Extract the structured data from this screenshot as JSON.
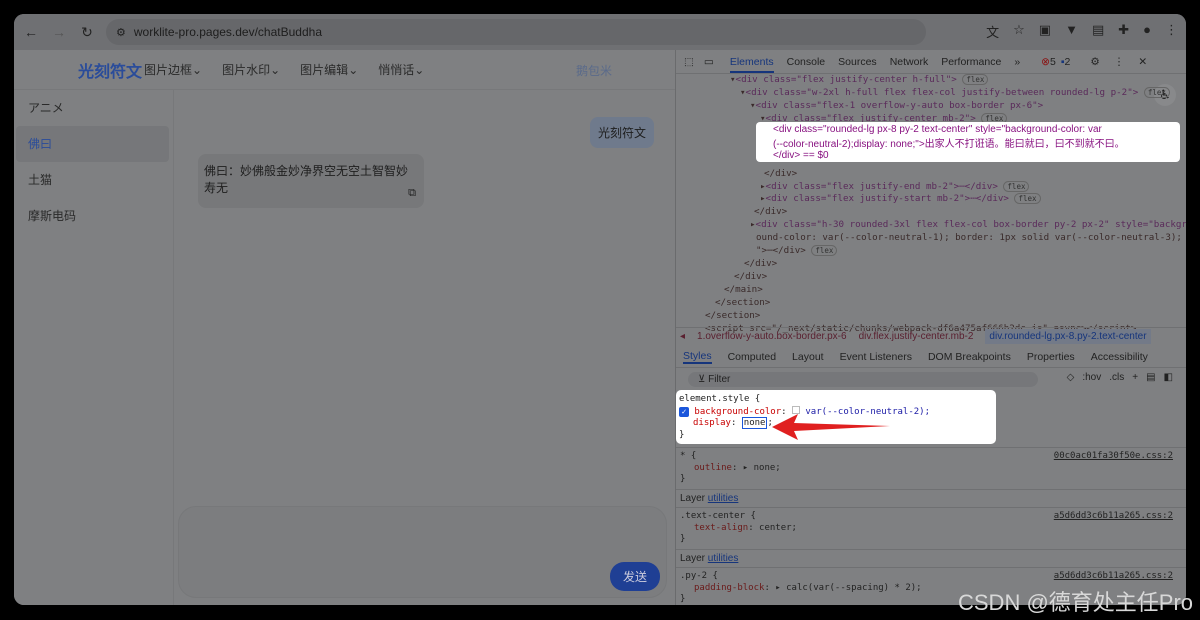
{
  "browser": {
    "url": "worklite-pro.pages.dev/chatBuddha"
  },
  "app": {
    "logo": "光刻符文",
    "menus": [
      "图片边框",
      "图片水印",
      "图片编辑",
      "悄悄话"
    ],
    "user": "鹅包米"
  },
  "sidebar": {
    "items": [
      "アニメ",
      "佛曰",
      "土猫",
      "摩斯电码"
    ],
    "active": 1
  },
  "chat": {
    "user_message": "光刻符文",
    "reply": "佛曰：妙佛般金妙净界空无空土智智妙寿无",
    "send_label": "发送"
  },
  "devtools": {
    "tabs": [
      "Elements",
      "Console",
      "Sources",
      "Network",
      "Performance"
    ],
    "errors": "5",
    "messages": "2",
    "flex_badge": "flex",
    "dom": [
      "<div class=\"flex justify-center h-full\">",
      "<div class=\"w-2xl h-full flex flex-col justify-between rounded-lg p-2\">",
      "<div class=\"flex-1 overflow-y-auto box-border px-6\">",
      "<div class=\"flex justify-center mb-2\">"
    ],
    "selected_line1": "<div class=\"rounded-lg px-8 py-2 text-center\" style=\"background-color: var",
    "selected_line2": "(--color-neutral-2);display: none;\">出家人不打诳语。能曰就曰，曰不到就不曰。",
    "selected_line3": "</div> == $0",
    "dom_after": [
      "</div>",
      "<div class=\"flex justify-end mb-2\">⋯</div>",
      "<div class=\"flex justify-start mb-2\">⋯</div>",
      "</div>",
      "<div class=\"h-30 rounded-3xl flex flex-col box-border py-2 px-2\" style=\"backgr",
      "ound-color: var(--color-neutral-1); border: 1px solid var(--color-neutral-3);",
      "\">⋯</div>",
      "</div>",
      "</div>",
      "</main>",
      "</section>",
      "</section>",
      "<script src=\"/_next/static/chunks/webpack-df6a475af666b2dc.js\" async></script>"
    ],
    "breadcrumbs": [
      "1.overflow-y-auto.box-border.px-6",
      "div.flex.justify-center.mb-2",
      "div.rounded-lg.px-8.py-2.text-center"
    ],
    "style_tabs": [
      "Styles",
      "Computed",
      "Layout",
      "Event Listeners",
      "DOM Breakpoints",
      "Properties",
      "Accessibility"
    ],
    "filter_placeholder": "Filter",
    "hov": ":hov",
    "cls": ".cls",
    "element_style": {
      "selector": "element.style {",
      "prop1": "background-color",
      "val1": "var(--color-neutral-2);",
      "prop2": "display",
      "val2": "none",
      "close": "}"
    },
    "rules": [
      {
        "selector": "* {",
        "prop": "outline",
        "val": "▸ none;",
        "src": "00c0ac01fa30f50e.css:2"
      },
      {
        "layer": "utilities",
        "selector": ".text-center {",
        "prop": "text-align",
        "val": "center;",
        "src": "a5d6dd3c6b11a265.css:2"
      },
      {
        "layer": "utilities",
        "selector": ".py-2 {",
        "prop": "padding-block",
        "val": "▸ calc(var(--spacing) * 2);",
        "src": "a5d6dd3c6b11a265.css:2"
      }
    ],
    "layer_label": "Layer"
  },
  "watermark": "CSDN @德育处主任Pro",
  "colors": {
    "accent": "#1a56db",
    "arrow": "#e02020"
  }
}
